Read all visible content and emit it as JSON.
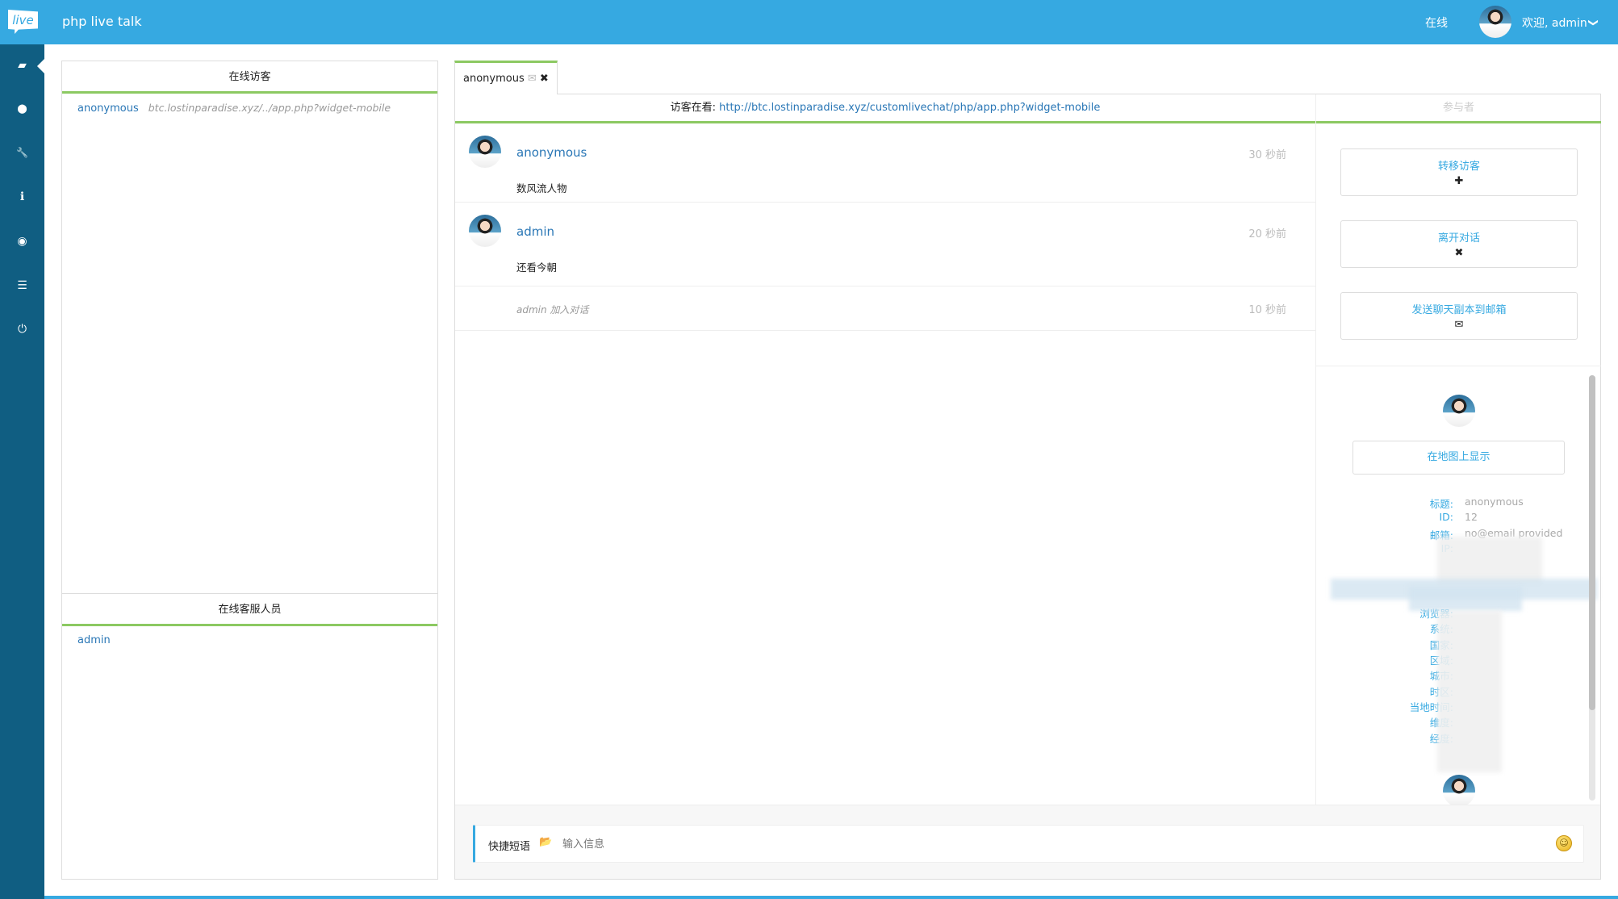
{
  "header": {
    "logo_text": "live",
    "app_title": "php live talk",
    "status": "在线",
    "welcome": "欢迎, admin",
    "chevron": "❯"
  },
  "sidebar": {
    "items": [
      {
        "name": "chat-icon",
        "glyph": "▰"
      },
      {
        "name": "map-marker-icon",
        "glyph": "⬤"
      },
      {
        "name": "wrench-icon",
        "glyph": "🔧"
      },
      {
        "name": "info-icon",
        "glyph": "ℹ"
      },
      {
        "name": "eye-icon",
        "glyph": "◉"
      },
      {
        "name": "list-icon",
        "glyph": "☰"
      },
      {
        "name": "power-icon",
        "glyph": "⏻"
      }
    ]
  },
  "left_panel": {
    "visitors_title": "在线访客",
    "visitors": [
      {
        "name": "anonymous",
        "url": "btc.lostinparadise.xyz/../app.php?widget-mobile"
      }
    ],
    "operators_title": "在线客服人员",
    "operators": [
      {
        "name": "admin"
      }
    ]
  },
  "chat": {
    "tab": {
      "label": "anonymous",
      "mail_icon": "✉",
      "close_icon": "✖"
    },
    "visitor_viewing_label": "访客在看: ",
    "visitor_viewing_url": "http://btc.lostinparadise.xyz/customlivechat/php/app.php?widget-mobile",
    "messages": [
      {
        "author": "anonymous",
        "time": "30 秒前",
        "text": "数风流人物"
      },
      {
        "author": "admin",
        "time": "20 秒前",
        "text": "还看今朝"
      }
    ],
    "system_message": {
      "text": "admin 加入对话",
      "time": "10 秒前"
    },
    "input": {
      "quick_phrases_label": "快捷短语",
      "folder_icon": "▬",
      "placeholder": "输入信息",
      "emoji_icon": "☺"
    }
  },
  "participants": {
    "title": "参与者",
    "actions": [
      {
        "label": "转移访客",
        "icon": "✚"
      },
      {
        "label": "离开对话",
        "icon": "✖"
      },
      {
        "label": "发送聊天副本到邮箱",
        "icon": "✉"
      }
    ],
    "show_on_map": "在地图上显示",
    "visitor_info": [
      {
        "label": "标题:",
        "value": "anonymous"
      },
      {
        "label": "ID:",
        "value": "12"
      },
      {
        "label": "邮箱:",
        "value": "no@email provided"
      },
      {
        "label": "IP:",
        "value": ""
      },
      {
        "label": "",
        "value": ""
      },
      {
        "label": "",
        "value": ""
      },
      {
        "label": "",
        "value": ""
      },
      {
        "label": "浏览器:",
        "value": ""
      },
      {
        "label": "系统:",
        "value": ""
      },
      {
        "label": "国家:",
        "value": ""
      },
      {
        "label": "区域:",
        "value": ""
      },
      {
        "label": "城市:",
        "value": ""
      },
      {
        "label": "时区:",
        "value": ""
      },
      {
        "label": "当地时间:",
        "value": ""
      },
      {
        "label": "维度:",
        "value": ""
      },
      {
        "label": "经度:",
        "value": ""
      }
    ]
  }
}
